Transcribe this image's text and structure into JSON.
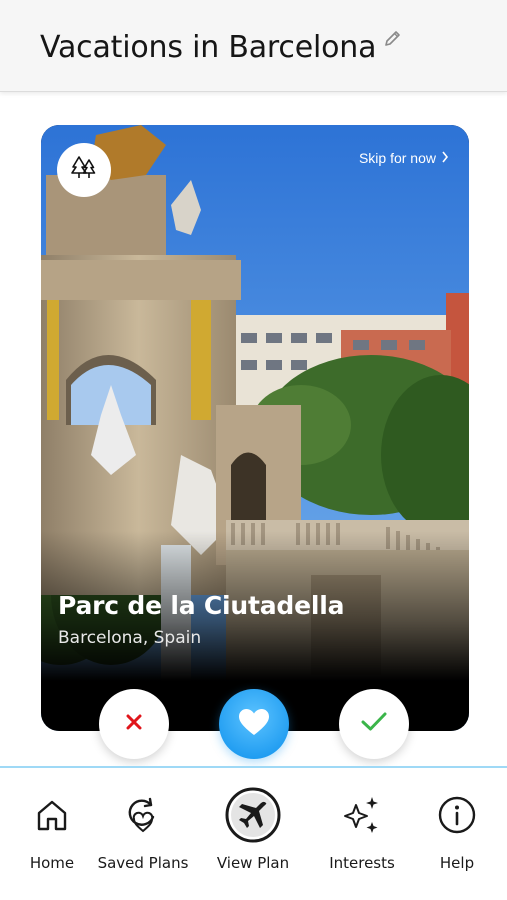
{
  "header": {
    "title": "Vacations in Barcelona",
    "edit_icon": "pencil-icon"
  },
  "card": {
    "category_icon": "trees-icon",
    "skip_label": "Skip for now",
    "place_name": "Parc de la Ciutadella",
    "place_location": "Barcelona, Spain"
  },
  "actions": {
    "reject_icon": "close-icon",
    "like_icon": "heart-icon",
    "accept_icon": "check-icon"
  },
  "colors": {
    "reject": "#e0151b",
    "like": "#1c9af0",
    "accept": "#3bb54a",
    "nav_accent": "#9fd9f6"
  },
  "nav": {
    "items": [
      {
        "label": "Home",
        "icon": "home-icon"
      },
      {
        "label": "Saved Plans",
        "icon": "saved-plans-icon"
      },
      {
        "label": "View Plan",
        "icon": "airplane-icon"
      },
      {
        "label": "Interests",
        "icon": "sparkles-icon"
      },
      {
        "label": "Help",
        "icon": "info-icon"
      }
    ]
  }
}
